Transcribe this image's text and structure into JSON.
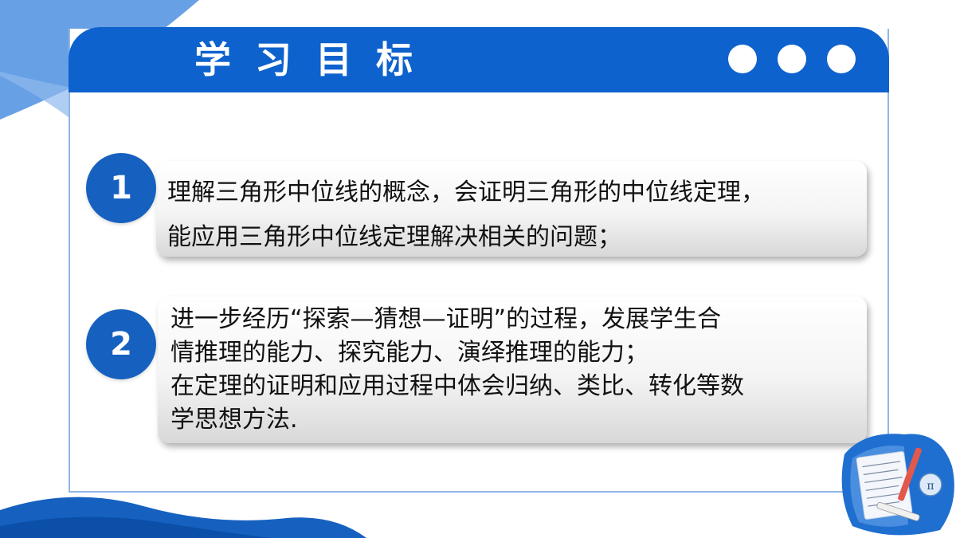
{
  "header": {
    "title": "学习目标",
    "accent_color": "#0d62cd"
  },
  "objectives": [
    {
      "number": "1",
      "lines": [
        "理解三角形中位线的概念，会证明三角形的中位线定理，",
        "能应用三角形中位线定理解决相关的问题；"
      ]
    },
    {
      "number": "2",
      "lines": [
        "进一步经历“探索—猜想—证明”的过程，发展学生合",
        "情推理的能力、探究能力、演绎推理的能力；",
        "在定理的证明和应用过程中体会归纳、类比、转化等数",
        "学思想方法."
      ]
    }
  ],
  "decorations": {
    "corner_icon": "math-notebook-icon",
    "header_dots_icon": "three-dots-icon"
  }
}
